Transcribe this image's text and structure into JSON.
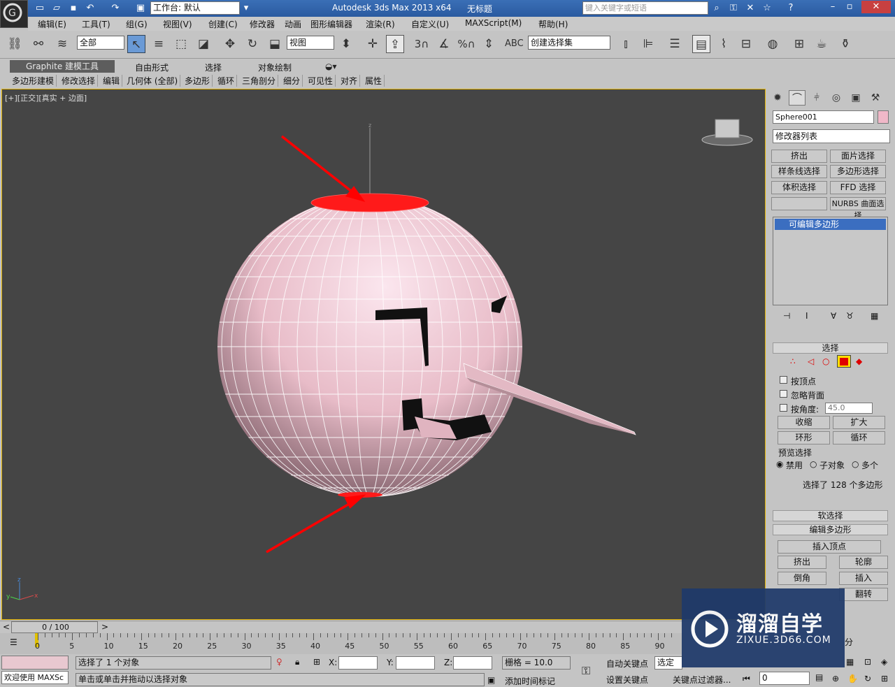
{
  "titlebar": {
    "workspace_value": "工作台: 默认",
    "app_title": "Autodesk 3ds Max  2013 x64",
    "doc_title": "无标题",
    "search_placeholder": "键入关键字或短语"
  },
  "menu": [
    "编辑(E)",
    "工具(T)",
    "组(G)",
    "视图(V)",
    "创建(C)",
    "修改器",
    "动画",
    "图形编辑器",
    "渲染(R)",
    "自定义(U)",
    "MAXScript(M)",
    "帮助(H)"
  ],
  "toolbar": {
    "filter_value": "全部",
    "coord_value": "视图",
    "snap_labels": [
      "3",
      "%"
    ],
    "selection_set_value": "创建选择集"
  },
  "graphite": {
    "tabs": [
      "Graphite 建模工具",
      "自由形式",
      "选择",
      "对象绘制"
    ],
    "ribbon": [
      "多边形建模",
      "修改选择",
      "编辑",
      "几何体 (全部)",
      "多边形",
      "循环",
      "三角剖分",
      "细分",
      "可见性",
      "对齐",
      "属性"
    ]
  },
  "viewport": {
    "label": "[+][正交][真实 + 边面]",
    "axis_labels": [
      "z",
      "x",
      "y"
    ]
  },
  "command_panel": {
    "object_name": "Sphere001",
    "modifier_list": "修改器列表",
    "buttons": [
      "挤出",
      "面片选择",
      "样条线选择",
      "多边形选择",
      "体积选择",
      "FFD 选择",
      "",
      "NURBS 曲面选择"
    ],
    "stack_item": "可编辑多边形",
    "selection_title": "选择",
    "by_vertex": "按顶点",
    "ignore_backface": "忽略背面",
    "by_angle": "按角度:",
    "angle_value": "45.0",
    "shrink": "收缩",
    "grow": "扩大",
    "ring": "环形",
    "loop": "循环",
    "preview_title": "预览选择",
    "preview_opts": [
      "禁用",
      "子对象",
      "多个"
    ],
    "selected_info": "选择了 128 个多边形",
    "soft_select": "软选择",
    "edit_poly": "编辑多边形",
    "insert_vertex": "插入顶点",
    "extrude": "挤出",
    "outline": "轮廓",
    "bevel": "倒角",
    "inset": "插入",
    "flip": "翻转",
    "partial": "分"
  },
  "timeline": {
    "frame_counter": "0 / 100",
    "ticks": [
      "0",
      "5",
      "10",
      "15",
      "20",
      "25",
      "30",
      "35",
      "40",
      "45",
      "50",
      "55",
      "60",
      "65",
      "70",
      "75",
      "80",
      "85",
      "90"
    ]
  },
  "status": {
    "welcome": "欢迎使用 MAXSc",
    "selected": "选择了 1 个对象",
    "hint": "单击或单击并拖动以选择对象",
    "x_label": "X:",
    "y_label": "Y:",
    "z_label": "Z:",
    "grid": "栅格 = 10.0",
    "add_time_tag": "添加时间标记",
    "auto_key": "自动关键点",
    "set_key": "设置关键点",
    "selected_obj": "选定对",
    "key_filter": "关键点过滤器...",
    "frame_value": "0"
  },
  "watermark": {
    "name": "溜溜自学",
    "url": "ZIXUE.3D66.COM"
  },
  "colors": {
    "viewport_bg": "#454545",
    "sphere": "#e8bcc8",
    "selection": "#ff1a1a",
    "arrow": "#ff0000",
    "stack_highlight": "#3b6ec0"
  }
}
